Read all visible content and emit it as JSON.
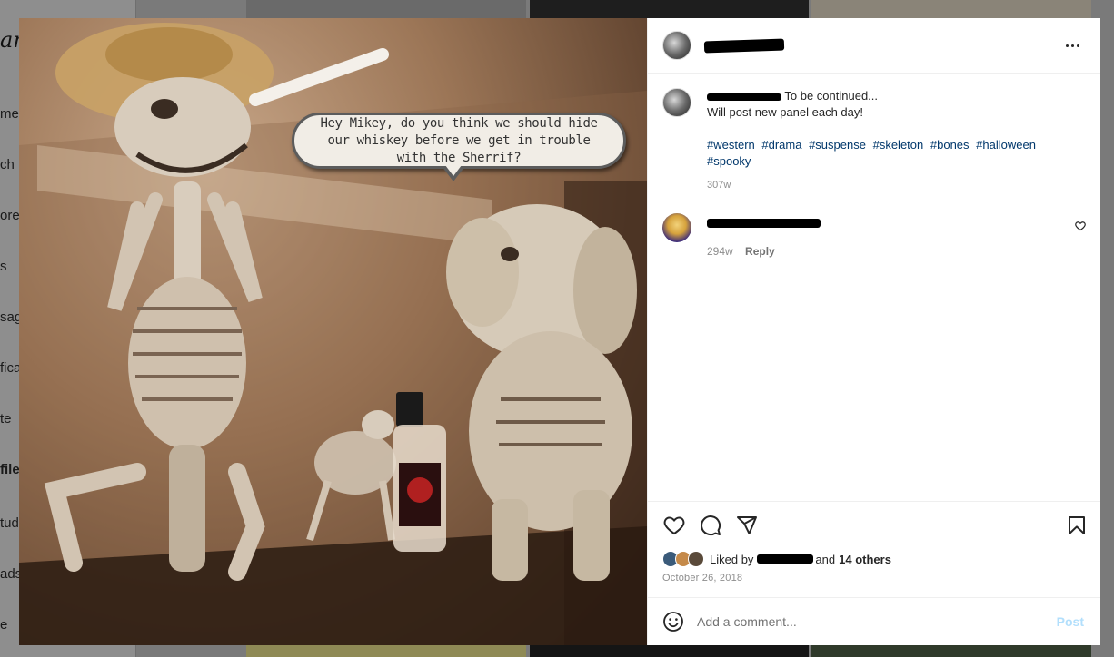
{
  "background": {
    "logo_fragment": "am",
    "nav_fragments": [
      "me",
      "ch",
      "ore",
      "s",
      "sag",
      "fica",
      "te",
      "file",
      "tud",
      "ads",
      "e"
    ]
  },
  "photo": {
    "speech_bubble": "Hey Mikey, do you think we should hide our whiskey before we get in trouble with the Sherrif?"
  },
  "header": {
    "more_icon": "ellipsis-icon"
  },
  "caption": {
    "text_line1": "To be continued...",
    "text_line2": "Will post new panel each day!",
    "hashtags": [
      "#western",
      "#drama",
      "#suspense",
      "#skeleton",
      "#bones",
      "#halloween",
      "#spooky"
    ],
    "age": "307w"
  },
  "comment": {
    "age": "294w",
    "reply_label": "Reply",
    "like_icon": "heart-icon"
  },
  "actions": {
    "like_icon": "heart-icon",
    "comment_icon": "speech-bubble-icon",
    "share_icon": "paper-plane-icon",
    "save_icon": "bookmark-icon"
  },
  "likes": {
    "liked_by_label": "Liked by",
    "and_label": "and",
    "others_label": "14 others"
  },
  "post_date": "October 26, 2018",
  "add_comment": {
    "placeholder": "Add a comment...",
    "post_label": "Post",
    "emoji_icon": "smiley-icon"
  },
  "colors": {
    "link": "#00376b",
    "post_disabled": "#b2dffc",
    "overlay_bg": "#7a7a7a"
  }
}
